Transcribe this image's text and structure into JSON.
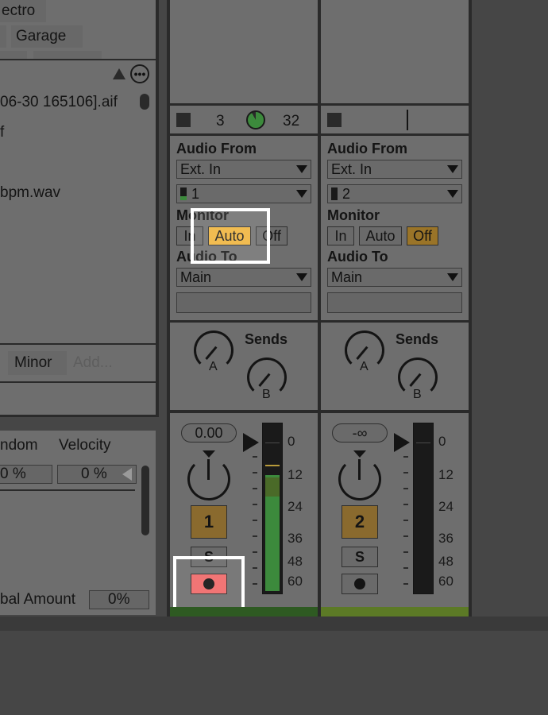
{
  "browser": {
    "tags": [
      "ectro",
      "Garage"
    ],
    "files": [
      "06-30 165106].aif",
      "f",
      "bpm.wav"
    ],
    "scale_chip": "Minor",
    "add_placeholder": "Add..."
  },
  "midi_panel": {
    "col_random": "ndom",
    "col_velocity": "Velocity",
    "random_value": "0 %",
    "velocity_value": "0 %",
    "global_label": "bal Amount",
    "global_value": "0%"
  },
  "tracks": [
    {
      "clip_stop": "3",
      "clip_count": "32",
      "audio_from_label": "Audio From",
      "audio_from": "Ext. In",
      "input_channel": "1",
      "monitor_label": "Monitor",
      "monitor_options": [
        "In",
        "Auto",
        "Off"
      ],
      "monitor_active": "Auto",
      "audio_to_label": "Audio To",
      "audio_to": "Main",
      "sends_label": "Sends",
      "send_a": "A",
      "send_b": "B",
      "volume": "0.00",
      "track_number": "1",
      "solo": "S",
      "arm_icon": "record-dot",
      "meter_labels": [
        "0",
        "12",
        "24",
        "36",
        "48",
        "60"
      ],
      "armed": true
    },
    {
      "audio_from_label": "Audio From",
      "audio_from": "Ext. In",
      "input_channel": "2",
      "monitor_label": "Monitor",
      "monitor_options": [
        "In",
        "Auto",
        "Off"
      ],
      "monitor_active": "Off",
      "audio_to_label": "Audio To",
      "audio_to": "Main",
      "sends_label": "Sends",
      "send_a": "A",
      "send_b": "B",
      "volume": "-∞",
      "track_number": "2",
      "solo": "S",
      "arm_icon": "record-dot",
      "meter_labels": [
        "0",
        "12",
        "24",
        "36",
        "48",
        "60"
      ],
      "armed": false
    }
  ],
  "colors": {
    "background": "#464646",
    "panel": "#6e6e6e",
    "monitor_auto": "#f0b33a",
    "monitor_off_active": "#9a7428",
    "track_number_bg": "#8a6a2e",
    "arm_active": "#f06a6a",
    "meter_green": "#3c8a3c",
    "highlight_outline": "#ffffff"
  }
}
